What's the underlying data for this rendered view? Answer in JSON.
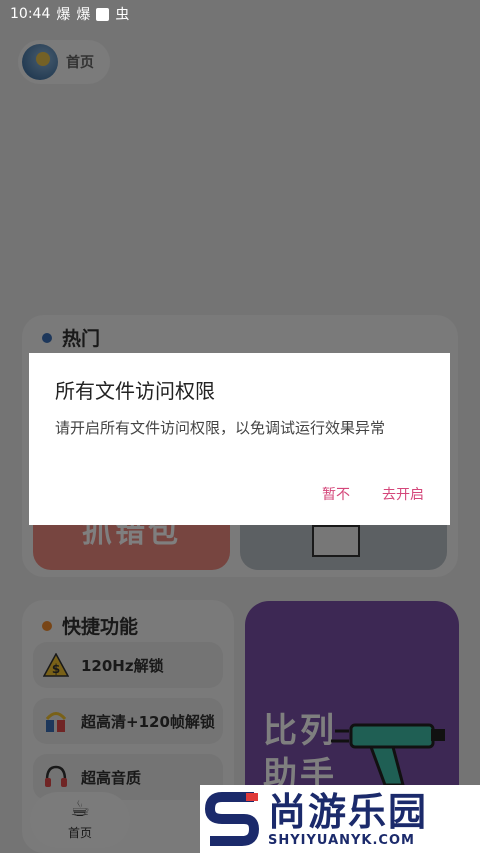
{
  "status_bar": {
    "time": "10:44",
    "icons": [
      "爆",
      "爆",
      "square-icon",
      "虫"
    ]
  },
  "home_chip": {
    "label": "首页"
  },
  "hot_section": {
    "title": "热门",
    "dot_color": "#3b6fb6",
    "red_tile_text": "抓错包"
  },
  "quick_section": {
    "title": "快捷功能",
    "dot_color": "#f08a2c",
    "items": [
      {
        "icon": "warning-icon",
        "label": "120Hz解锁"
      },
      {
        "icon": "tools-icon",
        "label": "超高清+120帧解锁"
      },
      {
        "icon": "headphones-icon",
        "label": "超高音质"
      }
    ]
  },
  "promo_card": {
    "line1": "比列",
    "line2": "助手",
    "color": "#7a50a8"
  },
  "bottom_nav": {
    "label": "首页",
    "icon": "coffee-cup-icon"
  },
  "dialog": {
    "title": "所有文件访问权限",
    "message": "请开启所有文件访问权限，以免调试运行效果异常",
    "cancel_label": "暂不",
    "confirm_label": "去开启",
    "accent_color": "#d4477a"
  },
  "watermark": {
    "cn": "尚游乐园",
    "en": "SHYIYUANYK.COM"
  }
}
